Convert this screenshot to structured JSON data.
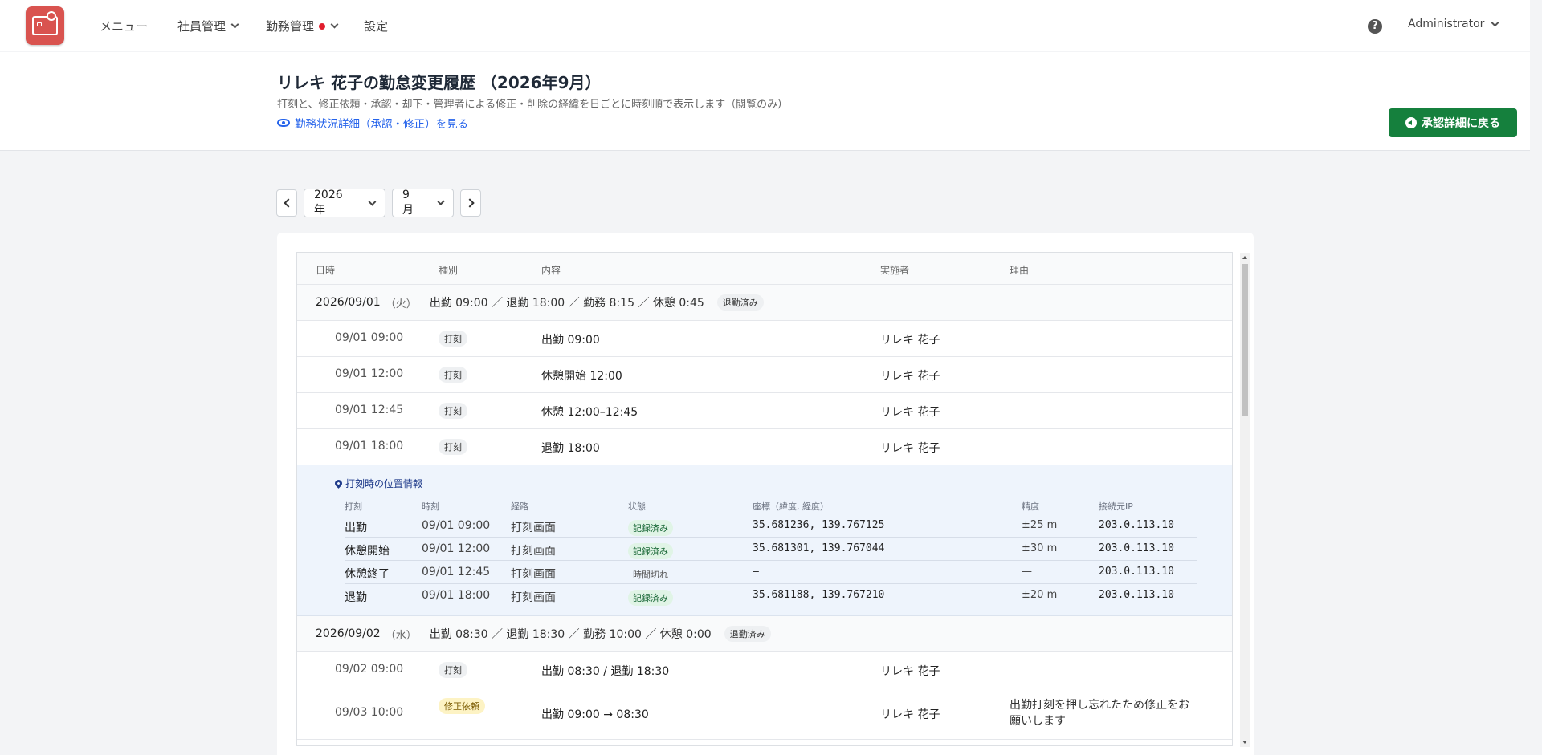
{
  "nav": {
    "menu": "メニュー",
    "employees": "社員管理",
    "attendance": "勤務管理",
    "settings": "設定",
    "help": "?",
    "user": "Administrator"
  },
  "header": {
    "title": "リレキ 花子の勤怠変更履歴 （2026年9月）",
    "description": "打刻と、修正依頼・承認・却下・管理者による修正・削除の経緯を日ごとに時刻順で表示します（閲覧のみ）",
    "detail_link": "勤務状況詳細（承認・修正）を見る",
    "back_button": "承認詳細に戻る"
  },
  "selector": {
    "year": "2026年",
    "month": "9月"
  },
  "columns": {
    "datetime": "日時",
    "kind": "種別",
    "content": "内容",
    "actor": "実施者",
    "reason": "理由"
  },
  "days": [
    {
      "date": "2026/09/01",
      "weekday": "（火）",
      "summary": "出勤 09:00 ／ 退勤 18:00 ／ 勤務 8:15 ／ 休憩 0:45",
      "status": "退勤済み",
      "records": [
        {
          "datetime": "09/01 09:00",
          "kind": "打刻",
          "content": "出勤 09:00",
          "actor": "リレキ 花子",
          "reason": ""
        },
        {
          "datetime": "09/01 12:00",
          "kind": "打刻",
          "content": "休憩開始 12:00",
          "actor": "リレキ 花子",
          "reason": ""
        },
        {
          "datetime": "09/01 12:45",
          "kind": "打刻",
          "content": "休憩 12:00–12:45",
          "actor": "リレキ 花子",
          "reason": ""
        },
        {
          "datetime": "09/01 18:00",
          "kind": "打刻",
          "content": "退勤 18:00",
          "actor": "リレキ 花子",
          "reason": ""
        }
      ],
      "location": {
        "title": "打刻時の位置情報",
        "headers": {
          "kind": "打刻",
          "time": "時刻",
          "route": "経路",
          "state": "状態",
          "coord": "座標（緯度, 経度）",
          "accuracy": "精度",
          "ip": "接続元IP"
        },
        "rows": [
          {
            "kind": "出勤",
            "time": "09/01 09:00",
            "route": "打刻画面",
            "state": "記録済み",
            "coord": "35.681236, 139.767125",
            "accuracy": "±25 m",
            "ip": "203.0.113.10"
          },
          {
            "kind": "休憩開始",
            "time": "09/01 12:00",
            "route": "打刻画面",
            "state": "記録済み",
            "coord": "35.681301, 139.767044",
            "accuracy": "±30 m",
            "ip": "203.0.113.10"
          },
          {
            "kind": "休憩終了",
            "time": "09/01 12:45",
            "route": "打刻画面",
            "state": "時間切れ",
            "coord": "—",
            "accuracy": "—",
            "ip": "203.0.113.10"
          },
          {
            "kind": "退勤",
            "time": "09/01 18:00",
            "route": "打刻画面",
            "state": "記録済み",
            "coord": "35.681188, 139.767210",
            "accuracy": "±20 m",
            "ip": "203.0.113.10"
          }
        ]
      }
    },
    {
      "date": "2026/09/02",
      "weekday": "（水）",
      "summary": "出勤 08:30 ／ 退勤 18:30 ／ 勤務 10:00 ／ 休憩 0:00",
      "status": "退勤済み",
      "records": [
        {
          "datetime": "09/02 09:00",
          "kind": "打刻",
          "content": "出勤 08:30 / 退勤 18:30",
          "actor": "リレキ 花子",
          "reason": ""
        },
        {
          "datetime": "09/03 10:00",
          "kind": "修正依頼",
          "content": "出勤 09:00 → 08:30",
          "actor": "リレキ 花子",
          "reason": "出勤打刻を押し忘れたため修正をお願いします"
        }
      ]
    }
  ],
  "colors": {
    "brand": "#d9534f",
    "accent_link": "#2563eb",
    "back_button": "#15803d",
    "status_ok": "#166534",
    "request_tag": "#fdf3c4"
  }
}
